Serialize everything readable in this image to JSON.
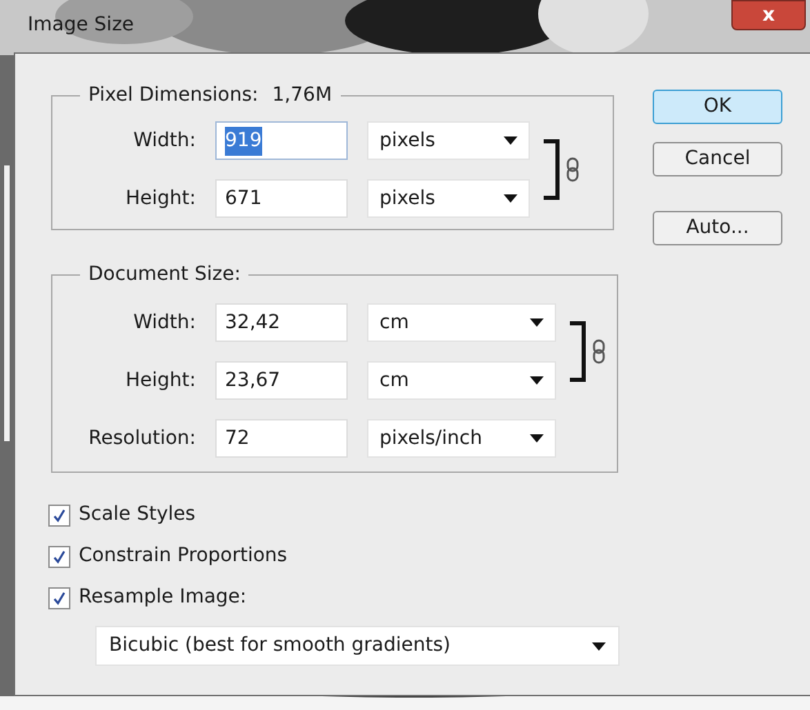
{
  "window": {
    "title": "Image Size",
    "close_label": "x"
  },
  "pixel_dimensions": {
    "title": "Pixel Dimensions:",
    "total": "1,76M",
    "linked": true,
    "fields": [
      {
        "label": "Width:",
        "value": "919",
        "text_selected": true,
        "unit": "pixels"
      },
      {
        "label": "Height:",
        "value": "671",
        "text_selected": false,
        "unit": "pixels"
      }
    ]
  },
  "document_size": {
    "title": "Document Size:",
    "linked": true,
    "fields": [
      {
        "label": "Width:",
        "value": "32,42",
        "unit": "cm"
      },
      {
        "label": "Height:",
        "value": "23,67",
        "unit": "cm"
      }
    ],
    "resolution": {
      "label": "Resolution:",
      "value": "72",
      "unit": "pixels/inch"
    }
  },
  "buttons": [
    {
      "label": "OK",
      "default": true
    },
    {
      "label": "Cancel",
      "default": false
    },
    {
      "label": "Auto...",
      "default": false
    }
  ],
  "options": [
    {
      "label": "Scale Styles",
      "checked": true
    },
    {
      "label": "Constrain Proportions",
      "checked": true
    },
    {
      "label": "Resample Image:",
      "checked": true
    }
  ],
  "resample_method": "Bicubic (best for smooth gradients)"
}
